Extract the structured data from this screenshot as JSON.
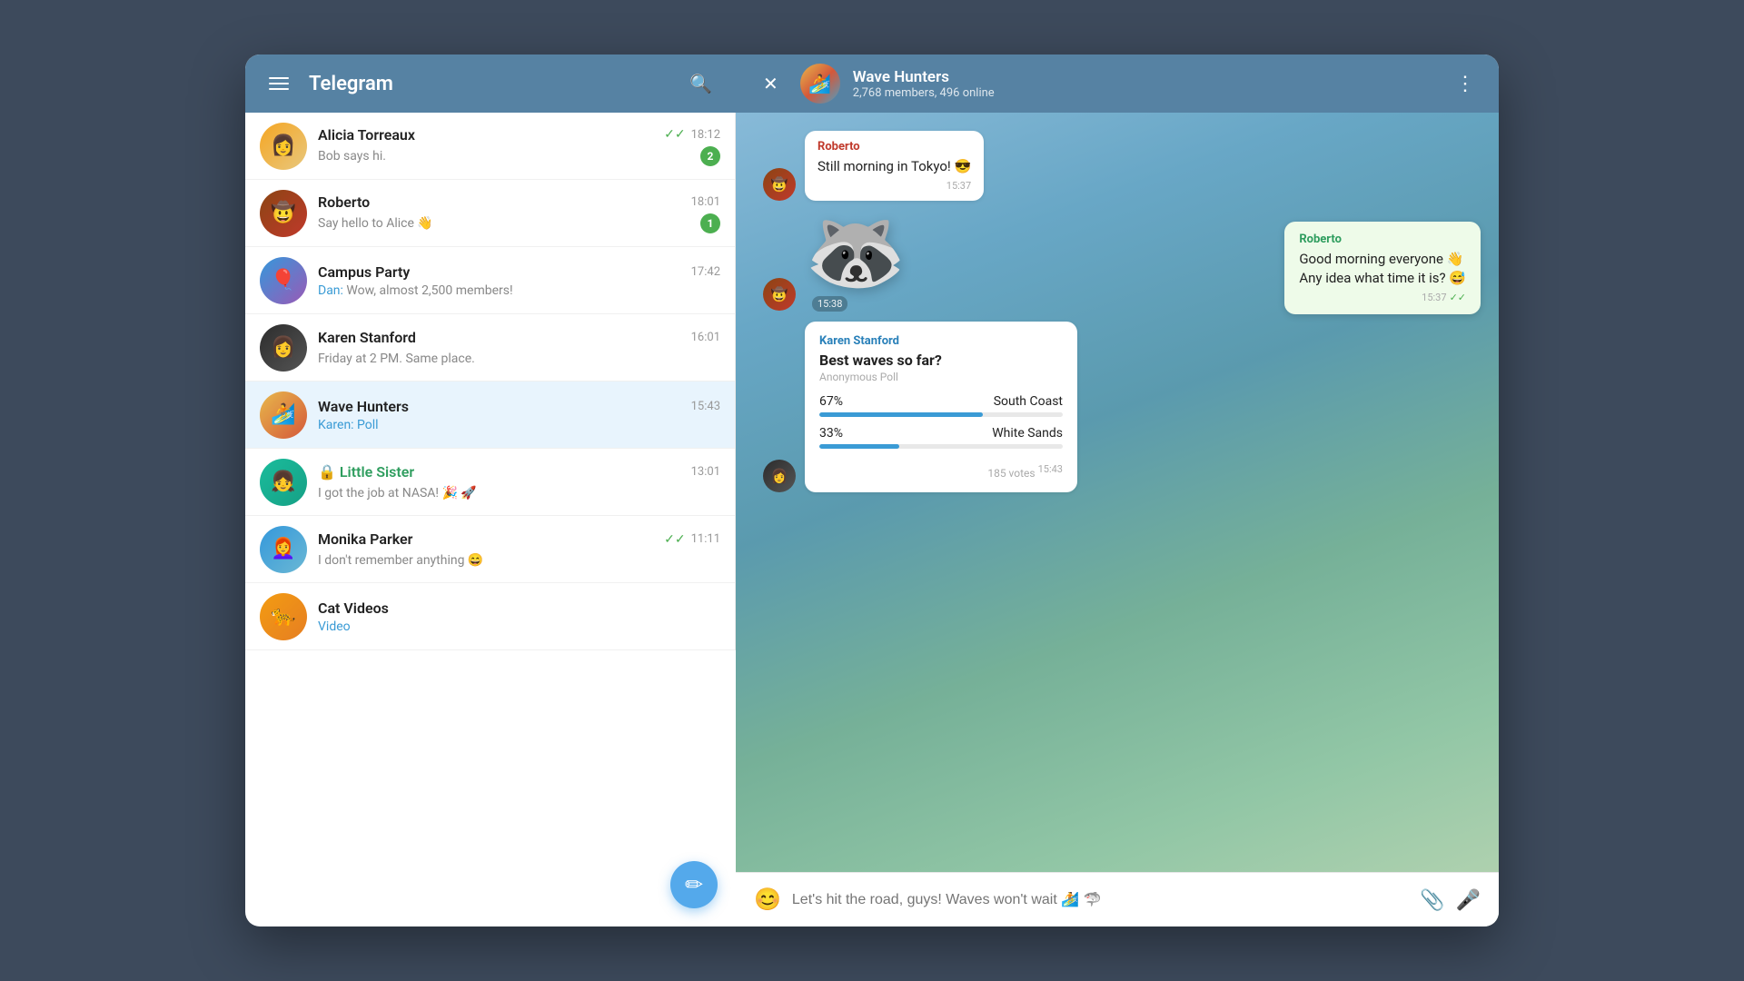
{
  "app": {
    "title": "Telegram",
    "window_bg": "#3d4a5c"
  },
  "header": {
    "menu_icon": "☰",
    "title": "Telegram",
    "search_icon": "🔍",
    "close_icon": "✕",
    "chat_name": "Wave Hunters",
    "chat_meta": "2,768 members, 496 online",
    "more_icon": "⋮"
  },
  "sidebar": {
    "compose_icon": "✏",
    "items": [
      {
        "id": "alicia",
        "name": "Alicia Torreaux",
        "time": "18:12",
        "preview": "Bob says hi.",
        "badge": 2,
        "has_check": true,
        "avatar_emoji": "👩"
      },
      {
        "id": "roberto",
        "name": "Roberto",
        "time": "18:01",
        "preview": "Say hello to Alice 👋",
        "badge": 1,
        "has_check": false,
        "avatar_emoji": "🤠"
      },
      {
        "id": "campus",
        "name": "Campus Party",
        "time": "17:42",
        "preview": "Dan: Wow, almost 2,500 members!",
        "badge": 0,
        "has_check": false,
        "avatar_emoji": "🎈"
      },
      {
        "id": "karen",
        "name": "Karen Stanford",
        "time": "16:01",
        "preview": "Friday at 2 PM. Same place.",
        "badge": 0,
        "has_check": false,
        "avatar_emoji": "👩‍🦱"
      },
      {
        "id": "wavehunters",
        "name": "Wave Hunters",
        "time": "15:43",
        "preview": "Karen: Poll",
        "badge": 0,
        "has_check": false,
        "active": true,
        "avatar_emoji": "🏄"
      },
      {
        "id": "littlesister",
        "name": "Little Sister",
        "time": "13:01",
        "preview": "I got the job at NASA! 🎉 🚀",
        "badge": 0,
        "has_check": false,
        "is_locked": true,
        "avatar_emoji": "👧"
      },
      {
        "id": "monika",
        "name": "Monika Parker",
        "time": "11:11",
        "preview": "I don't remember anything 😄",
        "badge": 0,
        "has_check": true,
        "avatar_emoji": "👩‍🦰"
      },
      {
        "id": "catvideos",
        "name": "Cat Videos",
        "time": "",
        "preview": "Video",
        "badge": 0,
        "has_check": false,
        "avatar_emoji": "🐆"
      }
    ]
  },
  "chat": {
    "messages": [
      {
        "id": "msg1",
        "sender": "Roberto",
        "sender_color": "roberto",
        "text": "Still morning in Tokyo! 😎",
        "time": "15:37",
        "outgoing": false
      },
      {
        "id": "msg2",
        "type": "sticker",
        "time": "15:38",
        "sticker": "🦝",
        "outgoing": false
      },
      {
        "id": "msg3",
        "type": "poll",
        "sender": "Karen Stanford",
        "sender_color": "karen",
        "poll_title": "Best waves so far?",
        "poll_type": "Anonymous Poll",
        "options": [
          {
            "label": "South Coast",
            "pct": 67
          },
          {
            "label": "White Sands",
            "pct": 33
          }
        ],
        "votes": "185 votes",
        "time": "15:43",
        "outgoing": false
      }
    ],
    "outgoing_message": {
      "sender": "Roberto",
      "text": "Good morning everyone 👋\nAny idea what time it is? 😅",
      "time": "15:37",
      "has_check": true
    },
    "input_placeholder": "Let's hit the road, guys! Waves won't wait 🏄 🦈",
    "emoji_icon": "😊",
    "attach_icon": "📎",
    "mic_icon": "🎤"
  }
}
